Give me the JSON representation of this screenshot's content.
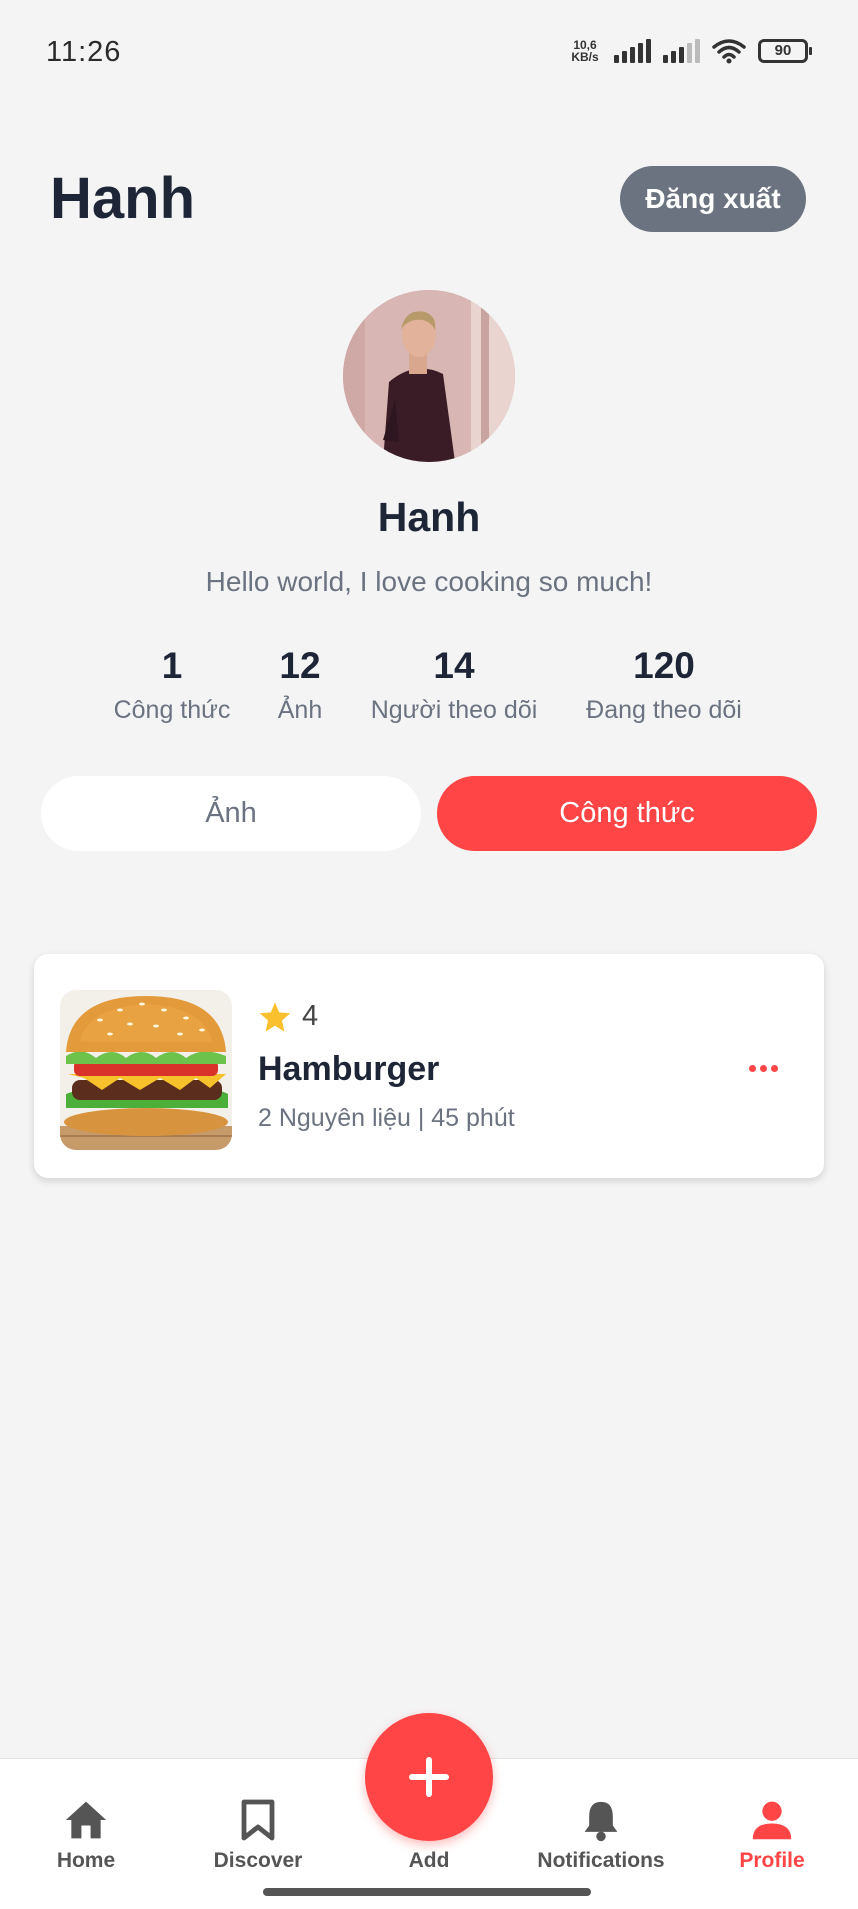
{
  "status_bar": {
    "time": "11:26",
    "net_speed_value": "10,6",
    "net_speed_unit": "KB/s",
    "battery": "90"
  },
  "header": {
    "title": "Hanh",
    "logout_label": "Đăng xuất"
  },
  "profile": {
    "name": "Hanh",
    "bio": "Hello world, I love cooking so much!"
  },
  "stats": [
    {
      "value": "1",
      "label": "Công thức"
    },
    {
      "value": "12",
      "label": "Ảnh"
    },
    {
      "value": "14",
      "label": "Người theo dõi"
    },
    {
      "value": "120",
      "label": "Đang theo dõi"
    }
  ],
  "tabs": {
    "photos": "Ảnh",
    "recipes": "Công thức",
    "active": "recipes"
  },
  "recipes": [
    {
      "rating": "4",
      "title": "Hamburger",
      "meta": "2 Nguyên liệu | 45 phút"
    }
  ],
  "bottom_nav": {
    "items": [
      {
        "label": "Home",
        "icon": "home-icon"
      },
      {
        "label": "Discover",
        "icon": "bookmark-icon"
      },
      {
        "label": "Add",
        "icon": "plus-icon"
      },
      {
        "label": "Notifications",
        "icon": "bell-icon"
      },
      {
        "label": "Profile",
        "icon": "person-icon"
      }
    ],
    "active": "Profile"
  },
  "colors": {
    "accent": "#ff4545",
    "logout_bg": "#6b7280",
    "background": "#f4f4f5"
  }
}
